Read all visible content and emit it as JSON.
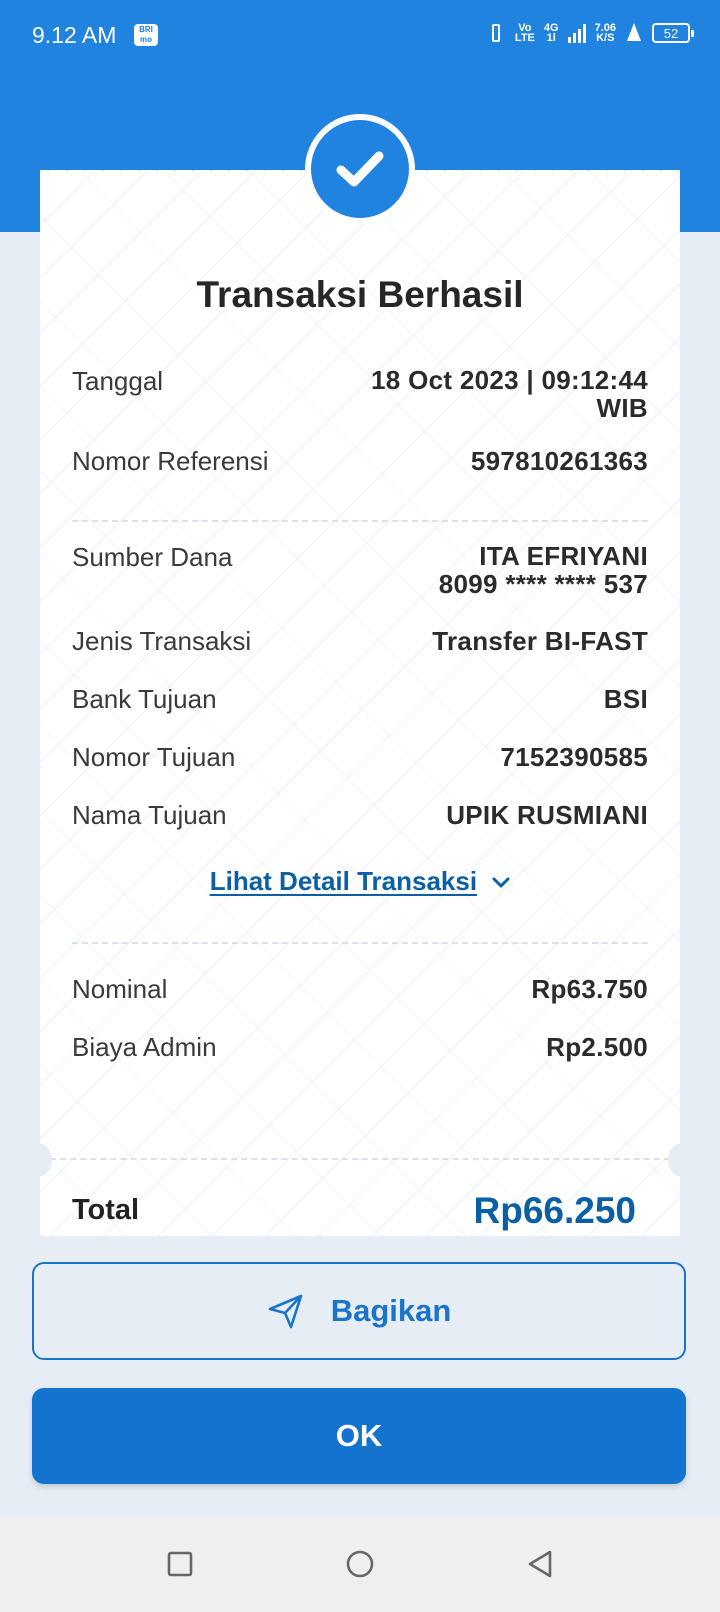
{
  "status_bar": {
    "time": "9.12 AM",
    "app_icon_text": "BRI mo",
    "volte_top": "Vo",
    "volte_bottom": "LTE",
    "network_top": "4G",
    "network_bottom": "1l",
    "speed_value": "7.06",
    "speed_unit": "K/S",
    "battery": "52"
  },
  "receipt": {
    "title": "Transaksi Berhasil",
    "icon": "check-icon",
    "rows_top": [
      {
        "label": "Tanggal",
        "value": "18 Oct 2023 | 09:12:44",
        "value2": "WIB"
      },
      {
        "label": "Nomor Referensi",
        "value": "597810261363"
      }
    ],
    "rows_middle": [
      {
        "label": "Sumber Dana",
        "value": "ITA EFRIYANI",
        "value2": "8099 **** **** 537"
      },
      {
        "label": "Jenis Transaksi",
        "value": "Transfer BI-FAST"
      },
      {
        "label": "Bank Tujuan",
        "value": "BSI"
      },
      {
        "label": "Nomor Tujuan",
        "value": "7152390585"
      },
      {
        "label": "Nama Tujuan",
        "value": "UPIK RUSMIANI"
      }
    ],
    "detail_link": "Lihat Detail Transaksi",
    "rows_amount": [
      {
        "label": "Nominal",
        "value": "Rp63.750"
      },
      {
        "label": "Biaya Admin",
        "value": "Rp2.500"
      }
    ],
    "total": {
      "label": "Total",
      "value": "Rp66.250"
    }
  },
  "buttons": {
    "share_label": "Bagikan",
    "share_icon": "send-icon",
    "ok_label": "OK"
  },
  "navigation": {
    "recent_icon": "square-icon",
    "home_icon": "circle-icon",
    "back_icon": "triangle-back-icon"
  },
  "colors": {
    "primary": "#2083e0",
    "button_blue": "#1473cf",
    "link_blue": "#0b5fa5",
    "background": "#e6edf4"
  }
}
